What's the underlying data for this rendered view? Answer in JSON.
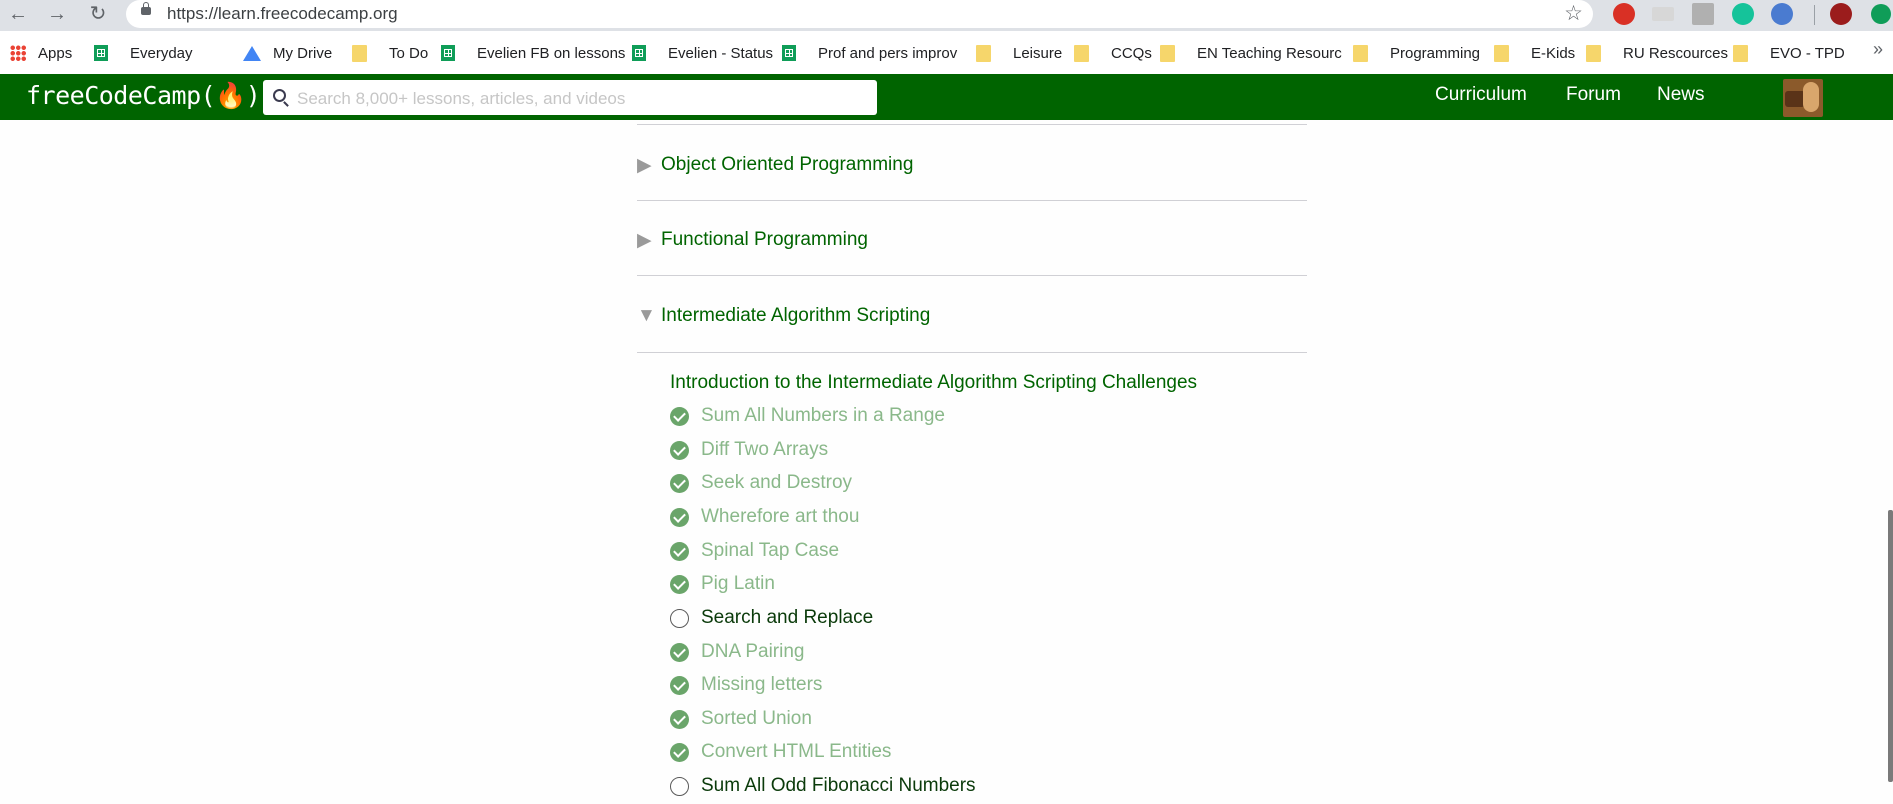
{
  "browser": {
    "url": "https://learn.freecodecamp.org",
    "nav_icons": [
      "back-arrow-icon",
      "forward-arrow-icon",
      "reload-icon"
    ],
    "extension_colors": [
      "#d93025",
      "#9e9e9e",
      "#9e9e9e",
      "#15c39a",
      "#4a7bd0",
      "#9b1c1c",
      "#0f9d58"
    ]
  },
  "bookmarks": [
    {
      "label": "Apps",
      "icon": "apps-icon"
    },
    {
      "label": "Everyday",
      "icon": "sheet-icon"
    },
    {
      "label": "My Drive",
      "icon": "drive-icon"
    },
    {
      "label": "To Do",
      "icon": "folder-icon"
    },
    {
      "label": "Evelien FB on lessons",
      "icon": "sheet-icon"
    },
    {
      "label": "Evelien - Status",
      "icon": "sheet-icon"
    },
    {
      "label": "Prof and pers improv",
      "icon": "sheet-icon"
    },
    {
      "label": "Leisure",
      "icon": "folder-icon"
    },
    {
      "label": "CCQs",
      "icon": "folder-icon"
    },
    {
      "label": "EN Teaching Resourc",
      "icon": "folder-icon"
    },
    {
      "label": "Programming",
      "icon": "folder-icon"
    },
    {
      "label": "E-Kids",
      "icon": "folder-icon"
    },
    {
      "label": "RU Rescources",
      "icon": "folder-icon"
    },
    {
      "label": "EVO - TPD",
      "icon": "folder-icon"
    }
  ],
  "fcc": {
    "logo": "freeCodeCamp(🔥)",
    "search_placeholder": "Search 8,000+ lessons, articles, and videos",
    "nav": [
      "Curriculum",
      "Forum",
      "News"
    ],
    "brand_color": "#006400"
  },
  "curriculum": {
    "blocks": [
      {
        "title": "Object Oriented Programming",
        "expanded": false
      },
      {
        "title": "Functional Programming",
        "expanded": false
      },
      {
        "title": "Intermediate Algorithm Scripting",
        "expanded": true
      }
    ],
    "intro": "Introduction to the Intermediate Algorithm Scripting Challenges",
    "challenges": [
      {
        "title": "Sum All Numbers in a Range",
        "completed": true
      },
      {
        "title": "Diff Two Arrays",
        "completed": true
      },
      {
        "title": "Seek and Destroy",
        "completed": true
      },
      {
        "title": "Wherefore art thou",
        "completed": true
      },
      {
        "title": "Spinal Tap Case",
        "completed": true
      },
      {
        "title": "Pig Latin",
        "completed": true
      },
      {
        "title": "Search and Replace",
        "completed": false
      },
      {
        "title": "DNA Pairing",
        "completed": true
      },
      {
        "title": "Missing letters",
        "completed": true
      },
      {
        "title": "Sorted Union",
        "completed": true
      },
      {
        "title": "Convert HTML Entities",
        "completed": true
      },
      {
        "title": "Sum All Odd Fibonacci Numbers",
        "completed": false
      }
    ]
  }
}
